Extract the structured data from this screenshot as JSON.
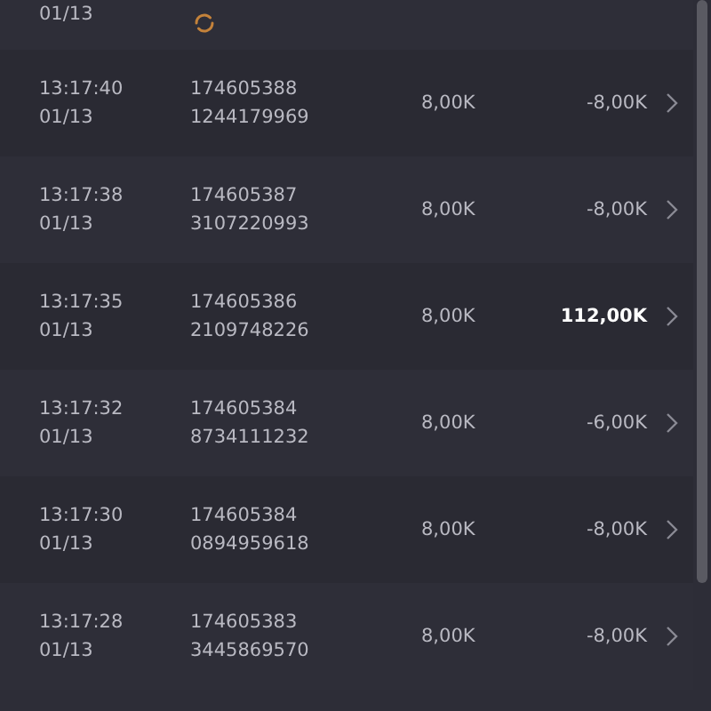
{
  "rows": [
    {
      "kind": "pending",
      "date": "01/13"
    },
    {
      "kind": "bet",
      "time": "13:17:40",
      "date": "01/13",
      "round": "174605388",
      "ticket": "1244179969",
      "bet": "8,00K",
      "win": "-8,00K",
      "won": false
    },
    {
      "kind": "bet",
      "time": "13:17:38",
      "date": "01/13",
      "round": "174605387",
      "ticket": "3107220993",
      "bet": "8,00K",
      "win": "-8,00K",
      "won": false
    },
    {
      "kind": "bet",
      "time": "13:17:35",
      "date": "01/13",
      "round": "174605386",
      "ticket": "2109748226",
      "bet": "8,00K",
      "win": "112,00K",
      "won": true
    },
    {
      "kind": "bet",
      "time": "13:17:32",
      "date": "01/13",
      "round": "174605384",
      "ticket": "8734111232",
      "bet": "8,00K",
      "win": "-6,00K",
      "won": false
    },
    {
      "kind": "bet",
      "time": "13:17:30",
      "date": "01/13",
      "round": "174605384",
      "ticket": "0894959618",
      "bet": "8,00K",
      "win": "-8,00K",
      "won": false
    },
    {
      "kind": "bet",
      "time": "13:17:28",
      "date": "01/13",
      "round": "174605383",
      "ticket": "3445869570",
      "bet": "8,00K",
      "win": "-8,00K",
      "won": false
    }
  ]
}
